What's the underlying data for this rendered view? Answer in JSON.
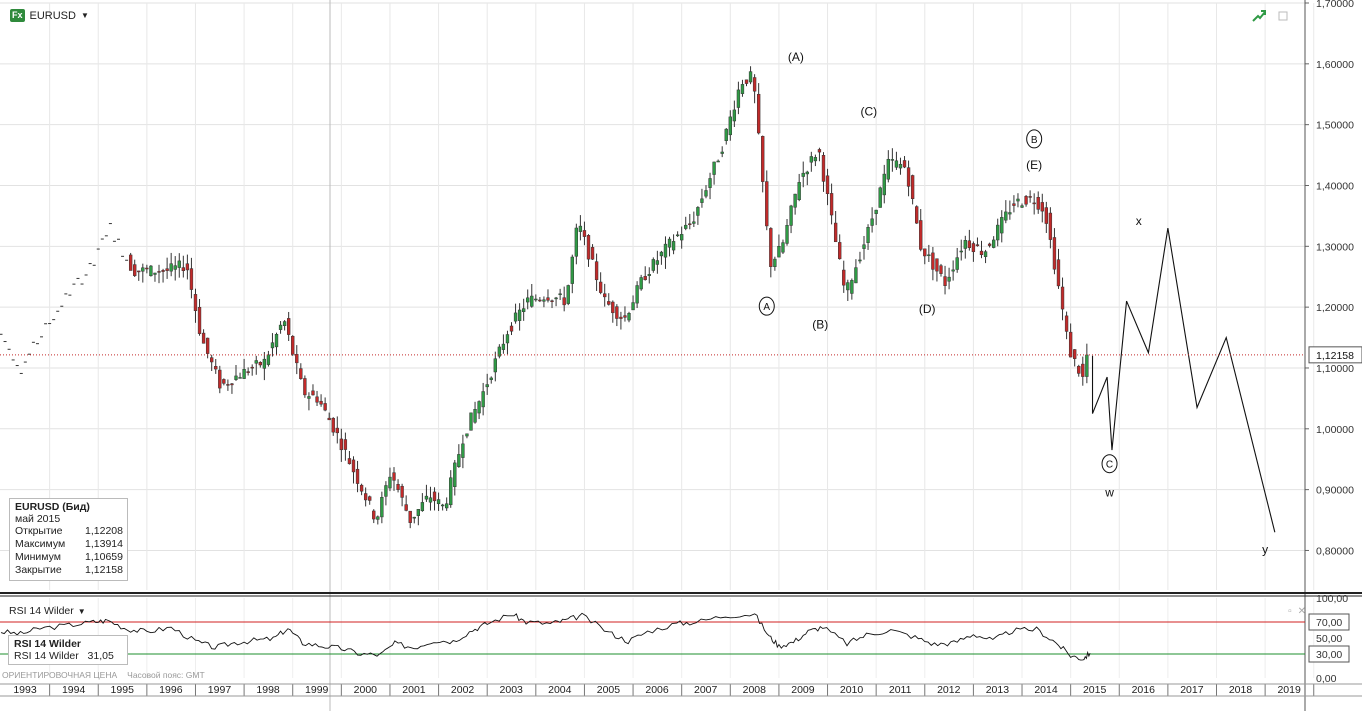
{
  "header": {
    "fx_badge": "Fx",
    "symbol": "EURUSD",
    "caret": "▼"
  },
  "current_price_label": "1,12158",
  "info_box": {
    "title": "EURUSD (Бид)",
    "period": "май 2015",
    "rows": [
      {
        "label": "Открытие",
        "value": "1,12208"
      },
      {
        "label": "Максимум",
        "value": "1,13914"
      },
      {
        "label": "Минимум",
        "value": "1,10659"
      },
      {
        "label": "Закрытие",
        "value": "1,12158"
      }
    ]
  },
  "rsi": {
    "title": "RSI 14 Wilder",
    "caret": "▼",
    "box_title": "RSI 14 Wilder",
    "box_label": "RSI 14 Wilder",
    "box_value": "31,05",
    "ytick_labels": [
      "100,00",
      "70,00",
      "50,00",
      "30,00",
      "0,00"
    ]
  },
  "footer": {
    "price_type": "ОРИЕНТИРОВОЧНАЯ ЦЕНА",
    "tz": "Часовой пояс: GMT"
  },
  "colors": {
    "up": "#2f9a45",
    "down": "#c22a2a",
    "rsi_70": "#d22020",
    "rsi_30": "#1c8f2c",
    "price_line": "#c42a2a"
  },
  "icons": [
    "trend-arrow-icon",
    "maximize-icon",
    "restore-icon",
    "close-icon"
  ],
  "chart_data": [
    {
      "type": "candlestick",
      "title": "EURUSD",
      "x_ticks": [
        "1993",
        "1994",
        "1995",
        "1996",
        "1997",
        "1998",
        "1999",
        "2000",
        "2001",
        "2002",
        "2003",
        "2004",
        "2005",
        "2006",
        "2007",
        "2008",
        "2009",
        "2010",
        "2011",
        "2012",
        "2013",
        "2014",
        "2015",
        "2016",
        "2017",
        "2018",
        "2019"
      ],
      "y_ticks": [
        "0,80000",
        "0,90000",
        "1,00000",
        "1,10000",
        "1,20000",
        "1,30000",
        "1,40000",
        "1,50000",
        "1,60000",
        "1,70000"
      ],
      "ylim": [
        0.735,
        1.7
      ],
      "series": [
        {
          "key": "anchors",
          "values": [
            [
              1993.0,
              1.165
            ],
            [
              1993.5,
              1.1
            ],
            [
              1994.0,
              1.165
            ],
            [
              1994.5,
              1.225
            ],
            [
              1995.0,
              1.27
            ],
            [
              1995.3,
              1.335
            ],
            [
              1995.8,
              1.26
            ],
            [
              1996.5,
              1.26
            ],
            [
              1996.9,
              1.27
            ],
            [
              1997.2,
              1.15
            ],
            [
              1997.6,
              1.07
            ],
            [
              1998.0,
              1.09
            ],
            [
              1998.5,
              1.11
            ],
            [
              1998.9,
              1.18
            ],
            [
              1999.3,
              1.06
            ],
            [
              1999.6,
              1.05
            ],
            [
              2000.0,
              0.99
            ],
            [
              2000.4,
              0.92
            ],
            [
              2000.8,
              0.85
            ],
            [
              2001.1,
              0.93
            ],
            [
              2001.5,
              0.85
            ],
            [
              2001.9,
              0.89
            ],
            [
              2002.2,
              0.87
            ],
            [
              2002.6,
              0.99
            ],
            [
              2003.0,
              1.06
            ],
            [
              2003.5,
              1.16
            ],
            [
              2003.9,
              1.21
            ],
            [
              2004.3,
              1.22
            ],
            [
              2004.7,
              1.21
            ],
            [
              2004.95,
              1.34
            ],
            [
              2005.5,
              1.21
            ],
            [
              2005.9,
              1.18
            ],
            [
              2006.3,
              1.25
            ],
            [
              2006.9,
              1.31
            ],
            [
              2007.3,
              1.34
            ],
            [
              2007.9,
              1.46
            ],
            [
              2008.3,
              1.57
            ],
            [
              2008.55,
              1.58
            ],
            [
              2008.9,
              1.27
            ],
            [
              2009.15,
              1.3
            ],
            [
              2009.5,
              1.41
            ],
            [
              2009.9,
              1.46
            ],
            [
              2010.45,
              1.22
            ],
            [
              2010.9,
              1.32
            ],
            [
              2011.35,
              1.44
            ],
            [
              2011.7,
              1.43
            ],
            [
              2012.0,
              1.3
            ],
            [
              2012.5,
              1.24
            ],
            [
              2012.9,
              1.31
            ],
            [
              2013.3,
              1.29
            ],
            [
              2013.6,
              1.33
            ],
            [
              2013.9,
              1.37
            ],
            [
              2014.3,
              1.38
            ],
            [
              2014.55,
              1.36
            ],
            [
              2014.8,
              1.25
            ],
            [
              2015.05,
              1.13
            ],
            [
              2015.35,
              1.08
            ],
            [
              2015.4,
              1.12
            ]
          ]
        },
        {
          "key": "forecast",
          "name": "",
          "values": [
            [
              2015.45,
              1.12
            ],
            [
              2015.45,
              1.025
            ],
            [
              2015.75,
              1.085
            ],
            [
              2015.85,
              0.965
            ],
            [
              2016.15,
              1.21
            ],
            [
              2016.6,
              1.125
            ],
            [
              2017.0,
              1.33
            ],
            [
              2017.6,
              1.035
            ],
            [
              2018.2,
              1.15
            ],
            [
              2019.2,
              0.83
            ]
          ]
        },
        {
          "key": "rsi",
          "name": "RSI 14 Wilder",
          "values": [
            [
              1993.0,
              58
            ],
            [
              1993.4,
              55
            ],
            [
              1993.8,
              62
            ],
            [
              1994.4,
              66
            ],
            [
              1994.9,
              70
            ],
            [
              1995.2,
              72
            ],
            [
              1995.6,
              61
            ],
            [
              1996.0,
              58
            ],
            [
              1996.5,
              63
            ],
            [
              1997.0,
              46
            ],
            [
              1997.4,
              38
            ],
            [
              1997.8,
              44
            ],
            [
              1998.2,
              47
            ],
            [
              1998.6,
              49
            ],
            [
              1998.9,
              62
            ],
            [
              1999.2,
              44
            ],
            [
              1999.6,
              40
            ],
            [
              2000.0,
              37
            ],
            [
              2000.4,
              30
            ],
            [
              2000.8,
              29
            ],
            [
              2001.1,
              43
            ],
            [
              2001.5,
              38
            ],
            [
              2001.9,
              47
            ],
            [
              2002.3,
              46
            ],
            [
              2002.7,
              60
            ],
            [
              2003.0,
              68
            ],
            [
              2003.5,
              80
            ],
            [
              2003.8,
              70
            ],
            [
              2004.3,
              68
            ],
            [
              2004.6,
              72
            ],
            [
              2004.95,
              78
            ],
            [
              2005.5,
              57
            ],
            [
              2005.9,
              46
            ],
            [
              2006.3,
              58
            ],
            [
              2006.9,
              68
            ],
            [
              2007.3,
              70
            ],
            [
              2007.9,
              78
            ],
            [
              2008.5,
              80
            ],
            [
              2008.8,
              52
            ],
            [
              2009.0,
              40
            ],
            [
              2009.3,
              45
            ],
            [
              2009.6,
              58
            ],
            [
              2009.9,
              64
            ],
            [
              2010.4,
              43
            ],
            [
              2010.8,
              54
            ],
            [
              2011.3,
              60
            ],
            [
              2011.8,
              51
            ],
            [
              2012.2,
              42
            ],
            [
              2012.6,
              44
            ],
            [
              2013.0,
              55
            ],
            [
              2013.4,
              47
            ],
            [
              2013.8,
              59
            ],
            [
              2014.3,
              61
            ],
            [
              2014.7,
              44
            ],
            [
              2015.0,
              28
            ],
            [
              2015.25,
              24
            ],
            [
              2015.4,
              31
            ]
          ]
        }
      ],
      "annotations": [
        {
          "label": "A",
          "circled": true,
          "x": 2008.75,
          "y": 1.195
        },
        {
          "label": "(A)",
          "circled": false,
          "x": 2009.35,
          "y": 1.605
        },
        {
          "label": "(B)",
          "circled": false,
          "x": 2009.85,
          "y": 1.165
        },
        {
          "label": "(C)",
          "circled": false,
          "x": 2010.85,
          "y": 1.515
        },
        {
          "label": "(D)",
          "circled": false,
          "x": 2012.05,
          "y": 1.19
        },
        {
          "label": "B",
          "circled": true,
          "x": 2014.25,
          "y": 1.47
        },
        {
          "label": "(E)",
          "circled": false,
          "x": 2014.25,
          "y": 1.427
        },
        {
          "label": "C",
          "circled": true,
          "x": 2015.8,
          "y": 0.936
        },
        {
          "label": "w",
          "circled": false,
          "x": 2015.8,
          "y": 0.889
        },
        {
          "label": "x",
          "circled": false,
          "x": 2016.4,
          "y": 1.335
        },
        {
          "label": "y",
          "circled": false,
          "x": 2019.0,
          "y": 0.795
        }
      ],
      "current_price": 1.12158
    }
  ]
}
